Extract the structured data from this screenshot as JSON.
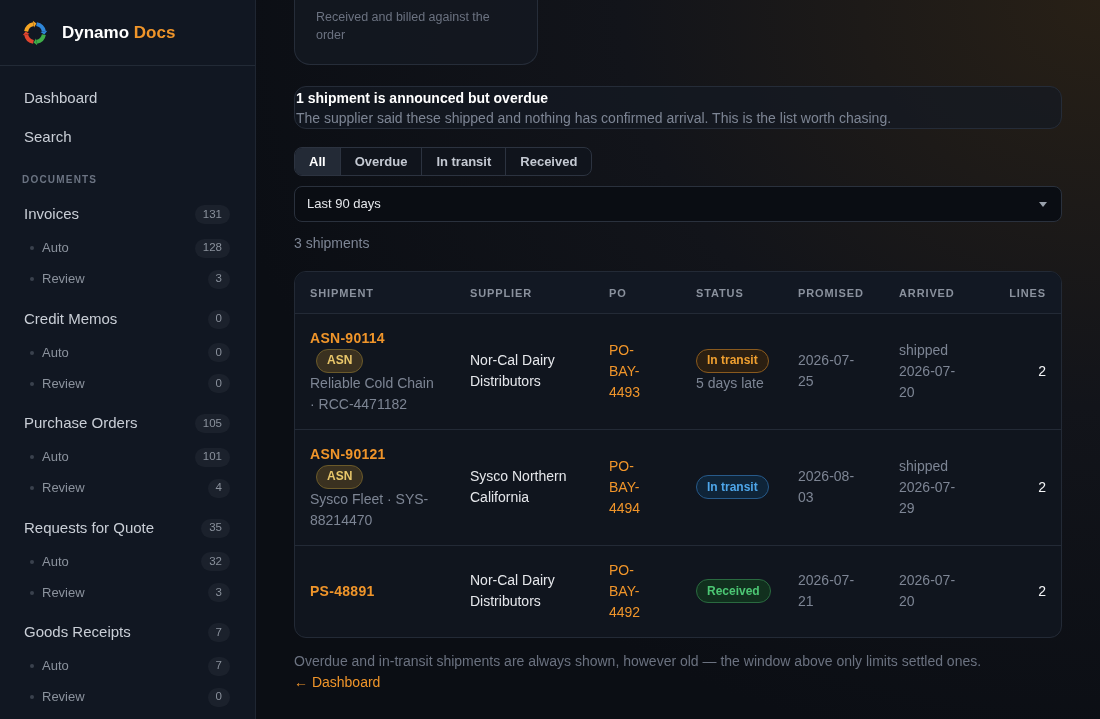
{
  "sidebar": {
    "brand": {
      "name": "Dynamo",
      "accent": "Docs"
    },
    "nav": [
      {
        "label": "Dashboard"
      },
      {
        "label": "Search"
      }
    ],
    "section_label": "DOCUMENTS",
    "groups": [
      {
        "label": "Invoices",
        "count": "131",
        "children": [
          {
            "label": "Auto",
            "count": "128"
          },
          {
            "label": "Review",
            "count": "3"
          }
        ]
      },
      {
        "label": "Credit Memos",
        "count": "0",
        "children": [
          {
            "label": "Auto",
            "count": "0"
          },
          {
            "label": "Review",
            "count": "0"
          }
        ]
      },
      {
        "label": "Purchase Orders",
        "count": "105",
        "children": [
          {
            "label": "Auto",
            "count": "101"
          },
          {
            "label": "Review",
            "count": "4"
          }
        ]
      },
      {
        "label": "Requests for Quote",
        "count": "35",
        "children": [
          {
            "label": "Auto",
            "count": "32"
          },
          {
            "label": "Review",
            "count": "3"
          }
        ]
      },
      {
        "label": "Goods Receipts",
        "count": "7",
        "children": [
          {
            "label": "Auto",
            "count": "7"
          },
          {
            "label": "Review",
            "count": "0"
          }
        ]
      }
    ]
  },
  "main": {
    "summary_card": {
      "text": "Received and billed against the order"
    },
    "alert": {
      "title": "1 shipment is announced but overdue",
      "text": "The supplier said these shipped and nothing has confirmed arrival. This is the list worth chasing."
    },
    "filter_tabs": [
      {
        "label": "All",
        "selected": true
      },
      {
        "label": "Overdue",
        "selected": false
      },
      {
        "label": "In transit",
        "selected": false
      },
      {
        "label": "Received",
        "selected": false
      }
    ],
    "range_select": {
      "value": "Last 90 days"
    },
    "result_count": "3 shipments",
    "table": {
      "columns": [
        "SHIPMENT",
        "SUPPLIER",
        "PO",
        "STATUS",
        "PROMISED",
        "ARRIVED",
        "LINES"
      ],
      "rows": [
        {
          "shipment": {
            "id": "ASN-90114",
            "tag": "ASN",
            "carrier": "Reliable Cold Chain · RCC-4471182"
          },
          "supplier": "Nor-Cal Dairy Distributors",
          "po": "PO-BAY-4493",
          "status": {
            "label": "In transit",
            "kind": "warning",
            "note": "5 days late"
          },
          "promised": "2026-07-25",
          "arrived": "shipped 2026-07-20",
          "lines": "2"
        },
        {
          "shipment": {
            "id": "ASN-90121",
            "tag": "ASN",
            "carrier": "Sysco Fleet · SYS-88214470"
          },
          "supplier": "Sysco Northern California",
          "po": "PO-BAY-4494",
          "status": {
            "label": "In transit",
            "kind": "info"
          },
          "promised": "2026-08-03",
          "arrived": "shipped 2026-07-29",
          "lines": "2"
        },
        {
          "shipment": {
            "id": "PS-48891"
          },
          "supplier": "Nor-Cal Dairy Distributors",
          "po": "PO-BAY-4492",
          "status": {
            "label": "Received",
            "kind": "success"
          },
          "promised": "2026-07-21",
          "arrived": "2026-07-20",
          "lines": "2"
        }
      ]
    },
    "footer_note": {
      "text": "Overdue and in-transit shipments are always shown, however old — the window above only limits settled ones.",
      "link": "← Dashboard"
    }
  }
}
